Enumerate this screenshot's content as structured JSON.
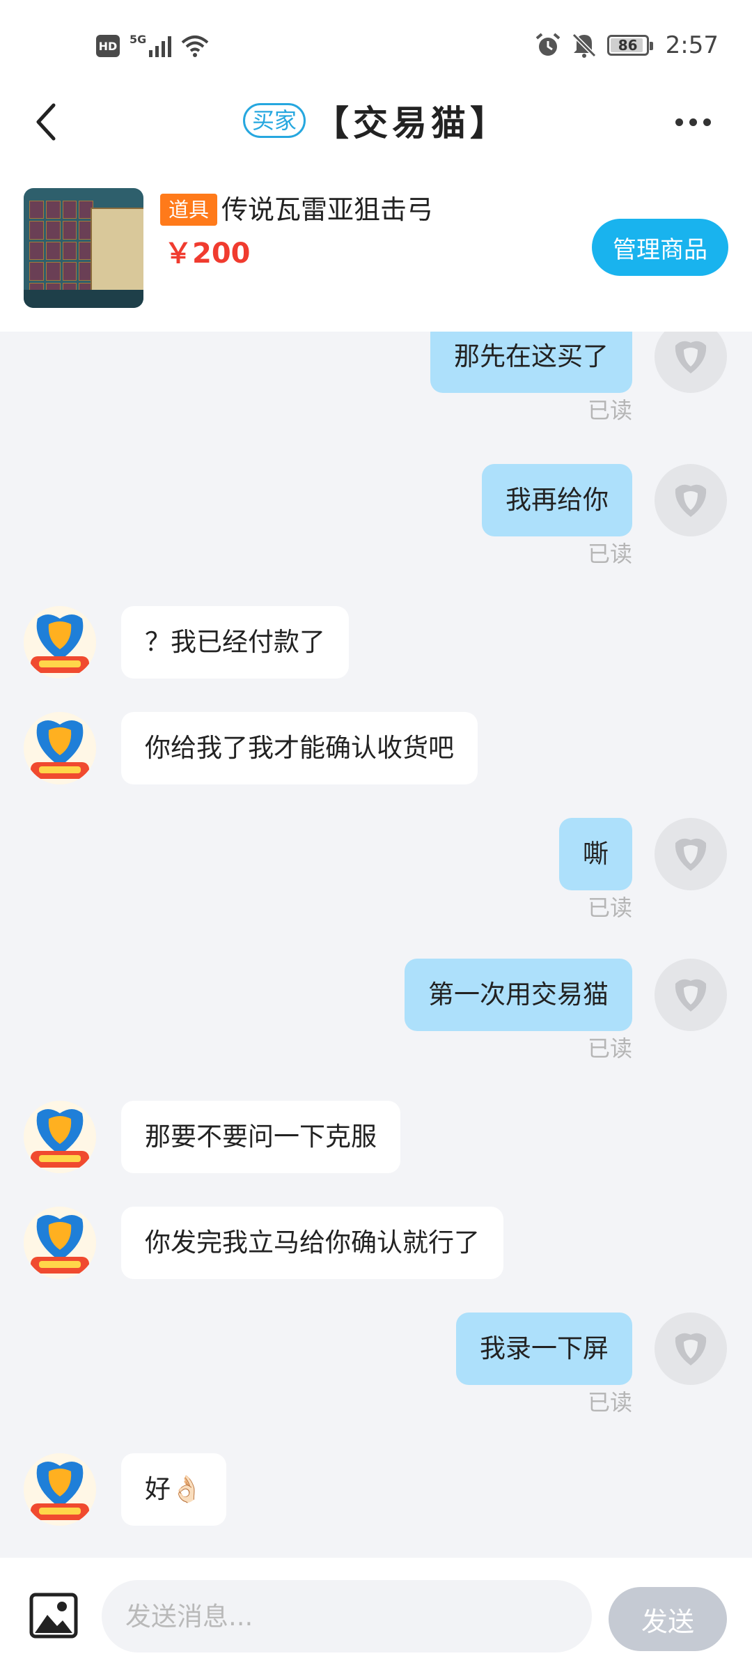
{
  "status_bar": {
    "hd_label": "HD",
    "network": "5G",
    "battery": "86",
    "time": "2:57",
    "icons": [
      "signal-icon",
      "wifi-icon",
      "alarm-icon",
      "mute-icon",
      "battery-icon"
    ]
  },
  "header": {
    "role_badge": "买家",
    "title": "【交易猫】",
    "back_icon": "chevron-left-icon",
    "more_icon": "more-dots-icon"
  },
  "product": {
    "tag": "道具",
    "name": "传说瓦雷亚狙击弓",
    "price": "￥200",
    "manage_label": "管理商品"
  },
  "messages": [
    {
      "from": "me",
      "text": "那先在这买了",
      "read": "已读"
    },
    {
      "from": "me",
      "text": "我再给你",
      "read": "已读"
    },
    {
      "from": "seller",
      "text": "？我已经付款了"
    },
    {
      "from": "seller",
      "text": "你给我了我才能确认收货吧"
    },
    {
      "from": "me",
      "text": "嘶",
      "read": "已读"
    },
    {
      "from": "me",
      "text": "第一次用交易猫",
      "read": "已读"
    },
    {
      "from": "seller",
      "text": "那要不要问一下克服"
    },
    {
      "from": "seller",
      "text": "你发完我立马给你确认就行了"
    },
    {
      "from": "me",
      "text": "我录一下屏",
      "read": "已读"
    },
    {
      "from": "seller",
      "text": "好👌🏻"
    }
  ],
  "input": {
    "placeholder": "发送消息...",
    "send_label": "发送",
    "image_icon": "image-icon"
  },
  "colors": {
    "accent": "#19b3ee",
    "out_bubble": "#ade0fb",
    "price": "#f03b2f",
    "tag": "#ff7a1a",
    "chat_bg": "#f3f4f7"
  }
}
